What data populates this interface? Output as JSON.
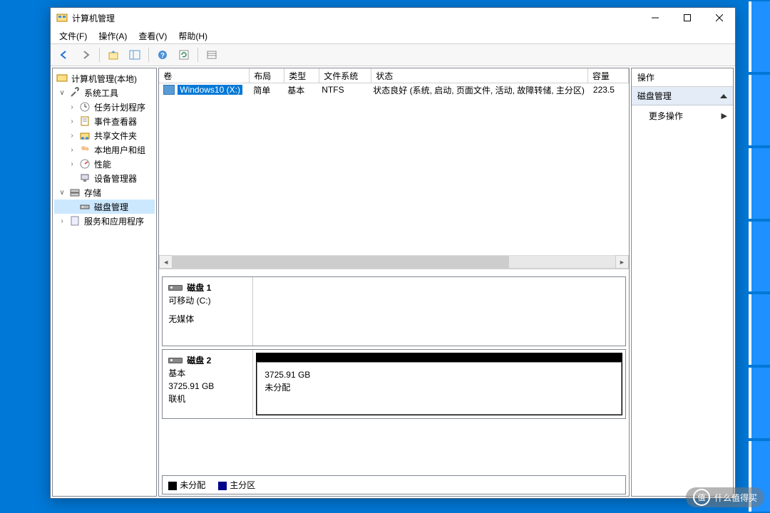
{
  "window": {
    "title": "计算机管理"
  },
  "menu": {
    "file": "文件(F)",
    "action": "操作(A)",
    "view": "查看(V)",
    "help": "帮助(H)"
  },
  "tree": {
    "root": "计算机管理(本地)",
    "sys_tools": "系统工具",
    "task_scheduler": "任务计划程序",
    "event_viewer": "事件查看器",
    "shared_folders": "共享文件夹",
    "local_users": "本地用户和组",
    "performance": "性能",
    "device_manager": "设备管理器",
    "storage": "存储",
    "disk_management": "磁盘管理",
    "services_apps": "服务和应用程序"
  },
  "vol_headers": {
    "volume": "卷",
    "layout": "布局",
    "type": "类型",
    "fs": "文件系统",
    "status": "状态",
    "capacity": "容量"
  },
  "vol_row": {
    "name": "Windows10 (X:)",
    "layout": "简单",
    "type": "基本",
    "fs": "NTFS",
    "status": "状态良好 (系统, 启动, 页面文件, 活动, 故障转储, 主分区)",
    "capacity": "223.5"
  },
  "disk1": {
    "title": "磁盘 1",
    "line1": "可移动 (C:)",
    "line2": "无媒体"
  },
  "disk2": {
    "title": "磁盘 2",
    "line1": "基本",
    "line2": "3725.91 GB",
    "line3": "联机",
    "part_size": "3725.91 GB",
    "part_status": "未分配"
  },
  "legend": {
    "unallocated": "未分配",
    "primary": "主分区"
  },
  "actions": {
    "header": "操作",
    "section": "磁盘管理",
    "more": "更多操作"
  },
  "watermark": "什么值得买"
}
